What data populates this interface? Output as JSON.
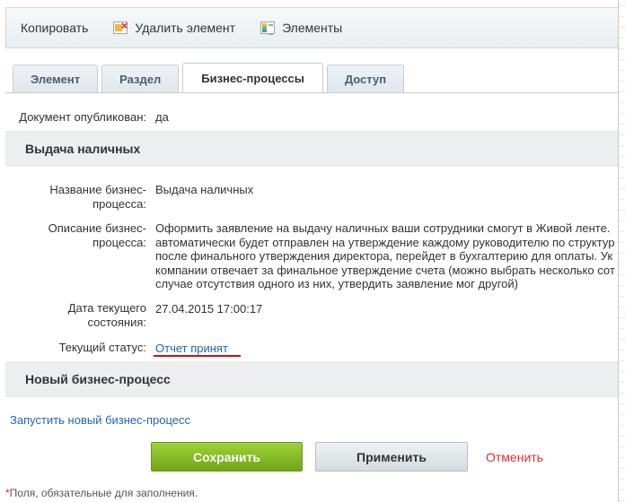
{
  "toolbar": {
    "copy_label": "Копировать",
    "delete_label": "Удалить элемент",
    "elements_label": "Элементы"
  },
  "tabs": [
    {
      "label": "Элемент",
      "active": false
    },
    {
      "label": "Раздел",
      "active": false
    },
    {
      "label": "Бизнес-процессы",
      "active": true
    },
    {
      "label": "Доступ",
      "active": false
    }
  ],
  "document": {
    "published_label": "Документ опубликован:",
    "published_value": "да"
  },
  "process_section": {
    "title": "Выдача наличных",
    "name_label_line1": "Название бизнес-",
    "name_label_line2": "процесса:",
    "name_value": "Выдача наличных",
    "desc_label_line1": "Описание бизнес-",
    "desc_label_line2": "процесса:",
    "desc_lines": [
      "Оформить заявление на выдачу наличных ваши сотрудники смогут в Живой ленте.",
      "автоматически будет отправлен на утверждение каждому руководителю по структур",
      "после финального утверждения директора, перейдет в бухгалтерию для оплаты. Ук",
      "компании отвечает за финальное утверждение счета (можно выбрать несколько сот",
      "случае отсутствия одного из них, утвердить заявление мог другой)"
    ],
    "date_label_line1": "Дата текущего",
    "date_label_line2": "состояния:",
    "date_value": "27.04.2015 17:00:17",
    "status_label": "Текущий статус:",
    "status_value": "Отчет принят"
  },
  "new_process_section": {
    "title": "Новый бизнес-процесс",
    "start_link": "Запустить новый бизнес-процесс"
  },
  "buttons": {
    "save": "Сохранить",
    "apply": "Применить",
    "cancel": "Отменить"
  },
  "footer": {
    "required_star": "*",
    "required_note": "Поля, обязательные для заполнения."
  },
  "colors": {
    "save_green": "#7fb527",
    "link_blue": "#2067b0",
    "cancel_red": "#d7312b",
    "underline_red": "#c0141a"
  }
}
